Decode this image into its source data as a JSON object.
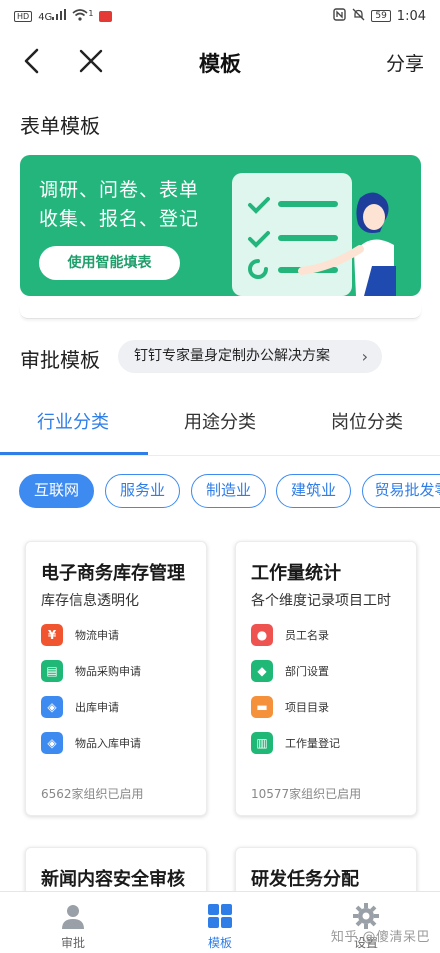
{
  "status_bar": {
    "left_badge": "HD",
    "signal_label": "4G",
    "wifi_sup": "1",
    "battery": "59",
    "time": "1:04"
  },
  "nav": {
    "title": "模板",
    "share": "分享"
  },
  "form_section": {
    "title": "表单模板",
    "banner_line1": "调研、问卷、表单",
    "banner_line2": "收集、报名、登记",
    "banner_button": "使用智能填表",
    "banner_color": "#24b57d"
  },
  "approval_section": {
    "title": "审批模板",
    "promo": "钉钉专家量身定制办公解决方案"
  },
  "tabs": [
    {
      "label": "行业分类",
      "active": true
    },
    {
      "label": "用途分类",
      "active": false
    },
    {
      "label": "岗位分类",
      "active": false
    }
  ],
  "chips": [
    {
      "label": "互联网",
      "active": true
    },
    {
      "label": "服务业",
      "active": false
    },
    {
      "label": "制造业",
      "active": false
    },
    {
      "label": "建筑业",
      "active": false
    },
    {
      "label": "贸易批发零",
      "active": false
    }
  ],
  "cards": [
    {
      "title": "电子商务库存管理",
      "subtitle": "库存信息透明化",
      "items": [
        {
          "label": "物流申请",
          "icon": "money-bag-icon",
          "color": "#f0552f"
        },
        {
          "label": "物品采购申请",
          "icon": "clipboard-icon",
          "color": "#1fb877"
        },
        {
          "label": "出库申请",
          "icon": "box-icon",
          "color": "#3d8af0"
        },
        {
          "label": "物品入库申请",
          "icon": "box-icon",
          "color": "#3d8af0"
        }
      ],
      "usage": "6562家组织已启用"
    },
    {
      "title": "工作量统计",
      "subtitle": "各个维度记录项目工时",
      "items": [
        {
          "label": "员工名录",
          "icon": "person-icon",
          "color": "#ef5350"
        },
        {
          "label": "部门设置",
          "icon": "cube-icon",
          "color": "#1fb877"
        },
        {
          "label": "项目目录",
          "icon": "folder-icon",
          "color": "#f5913a"
        },
        {
          "label": "工作量登记",
          "icon": "notebook-icon",
          "color": "#1fb877"
        }
      ],
      "usage": "10577家组织已启用"
    },
    {
      "title": "新闻内容安全审核"
    },
    {
      "title": "研发任务分配"
    }
  ],
  "bottom_nav": [
    {
      "label": "审批",
      "icon": "person-icon",
      "active": false
    },
    {
      "label": "模板",
      "icon": "grid-icon",
      "active": true
    },
    {
      "label": "设置",
      "icon": "gear-icon",
      "active": false
    }
  ],
  "watermark": "知乎 @傻清呆巴",
  "accent_color": "#2f7ee8"
}
